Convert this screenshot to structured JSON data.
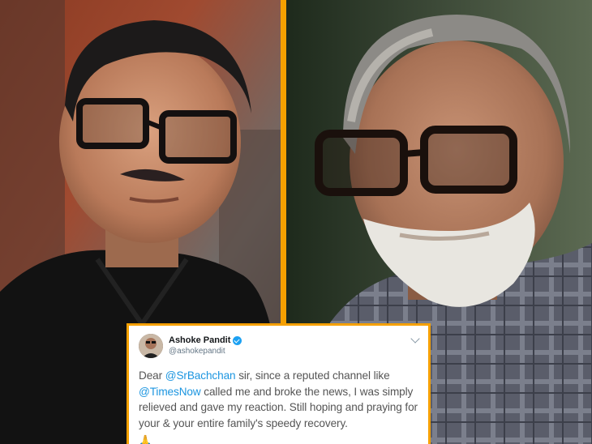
{
  "colors": {
    "frame": "#f5a000",
    "mention": "#1b95e0",
    "verified": "#1da1f2"
  },
  "tweet": {
    "display_name": "Ashoke Pandit",
    "handle": "@ashokepandit",
    "verified": true,
    "text_dear": "Dear ",
    "mention_1": "@SrBachchan",
    "text_1": " sir, since a reputed channel like",
    "mention_2": "@TimesNow",
    "text_2": " called me and broke the news, I was simply relieved and gave my reaction. Still hoping and praying for your & your entire family's speedy recovery.",
    "emoji": "🙏"
  },
  "icons": {
    "verified": "verified-badge-icon",
    "menu": "chevron-down-icon",
    "emoji": "folded-hands-icon"
  }
}
